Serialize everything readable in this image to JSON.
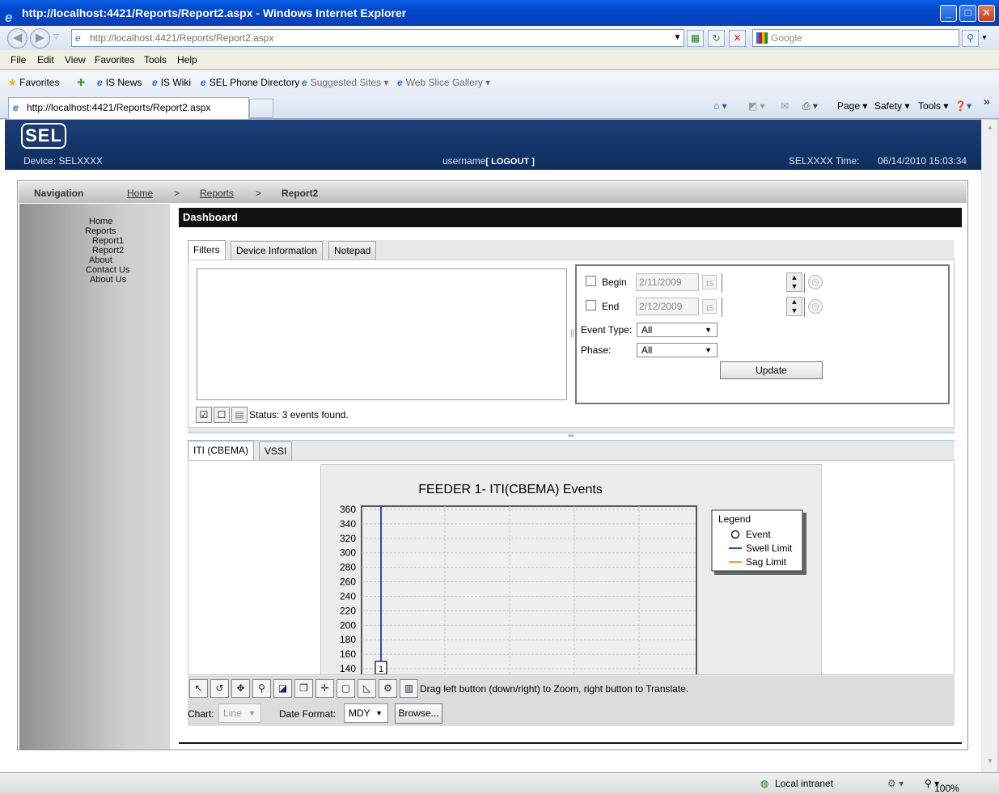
{
  "window": {
    "title": "http://localhost:4421/Reports/Report2.aspx - Windows Internet Explorer"
  },
  "address": {
    "url": "http://localhost:4421/Reports/Report2.aspx",
    "search_placeholder": "Google"
  },
  "menu": [
    "File",
    "Edit",
    "View",
    "Favorites",
    "Tools",
    "Help"
  ],
  "favorites": {
    "label": "Favorites",
    "items": [
      "IS News",
      "IS Wiki",
      "SEL Phone Directory",
      "Suggested Sites",
      "Web Slice Gallery"
    ]
  },
  "tab": {
    "title": "http://localhost:4421/Reports/Report2.aspx"
  },
  "commands": [
    "Page",
    "Safety",
    "Tools"
  ],
  "banner": {
    "logo": "SEL",
    "device": "Device: SELXXXX",
    "username": "username",
    "logout": "[ LOGOUT ]",
    "time_label": "SELXXXX Time:",
    "time_value": "06/14/2010 15:03:34"
  },
  "breadcrumb": {
    "label": "Navigation",
    "home": "Home",
    "sep": ">",
    "reports": "Reports",
    "current": "Report2"
  },
  "sidebar": [
    "Home",
    "Reports",
    "Report1",
    "Report2",
    "About",
    "Contact Us",
    "About Us"
  ],
  "dashboard": {
    "title": "Dashboard",
    "tabs": [
      "Filters",
      "Device Information",
      "Notepad"
    ],
    "filters": {
      "begin_label": "Begin",
      "begin_value": "2/11/2009",
      "end_label": "End",
      "end_value": "2/12/2009",
      "cal_day": "15",
      "event_type_label": "Event Type:",
      "event_type_value": "All",
      "phase_label": "Phase:",
      "phase_value": "All",
      "update_button": "Update"
    },
    "status": "Status: 3 events found."
  },
  "chart_tabs": [
    "ITI (CBEMA)",
    "VSSI"
  ],
  "chart_toolbar": {
    "hint": "Drag left button (down/right) to Zoom, right button to Translate.",
    "chart_label": "Chart:",
    "chart_value": "Line",
    "date_format_label": "Date Format:",
    "date_format_value": "MDY",
    "browse_button": "Browse..."
  },
  "chart_data": {
    "type": "line",
    "title": "FEEDER 1- ITI(CBEMA) Events",
    "y_ticks": [
      360,
      340,
      320,
      300,
      280,
      260,
      240,
      220,
      200,
      180,
      160,
      140
    ],
    "ylim": [
      130,
      370
    ],
    "legend_title": "Legend",
    "legend": [
      {
        "name": "Event",
        "symbol": "circle",
        "color": "#000000"
      },
      {
        "name": "Swell Limit",
        "symbol": "line",
        "color": "#2b4fa8"
      },
      {
        "name": "Sag Limit",
        "symbol": "line",
        "color": "#f0a030"
      }
    ],
    "marker_label": "1",
    "grid": true,
    "legend_position": "right"
  },
  "statusbar": {
    "zone": "Local intranet",
    "zoom": "100%"
  }
}
